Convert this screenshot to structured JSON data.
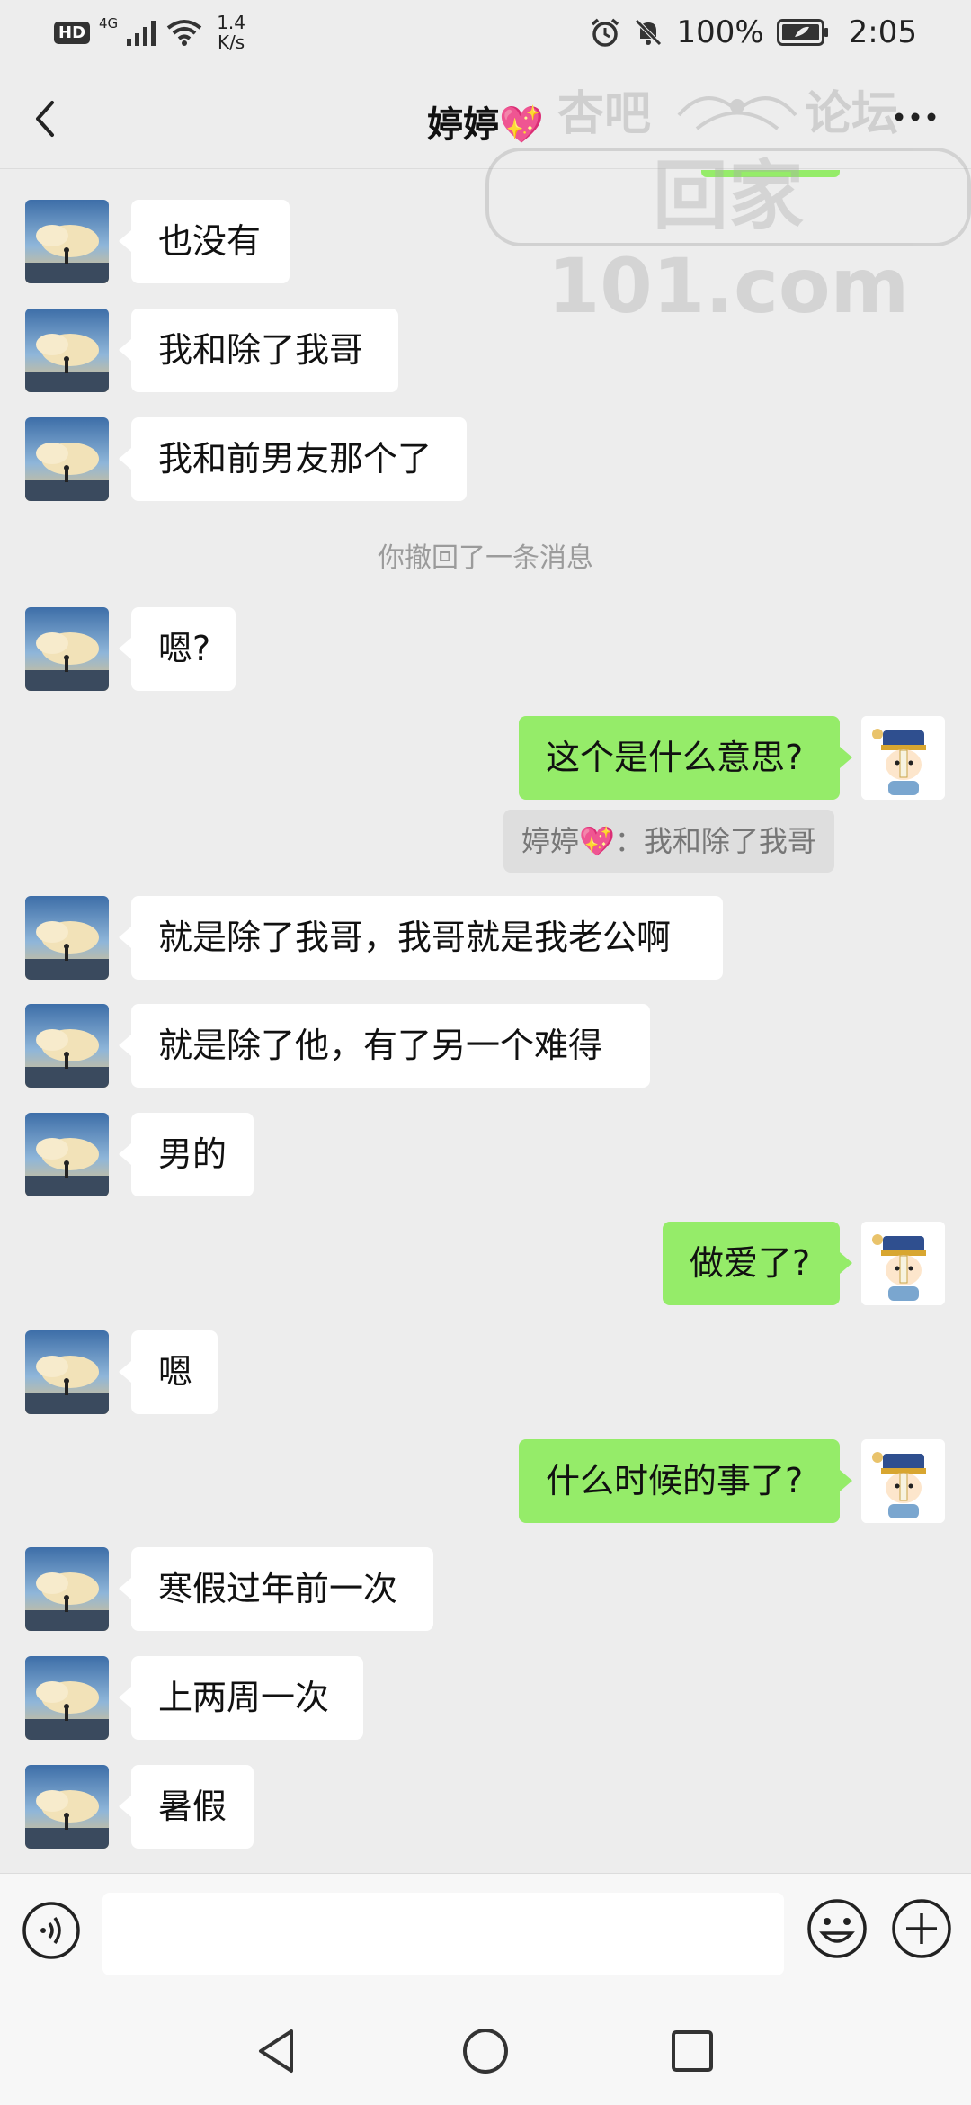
{
  "status_bar": {
    "hd": "HD",
    "network": "4G",
    "speed_value": "1.4",
    "speed_unit": "K/s",
    "battery": "100%",
    "time": "2:05"
  },
  "header": {
    "title": "婷婷💖"
  },
  "watermark": {
    "top_left": "杏吧",
    "top_right": "论坛",
    "main": "回家101.com"
  },
  "messages": [
    {
      "side": "left",
      "text": "也没有"
    },
    {
      "side": "left",
      "text": "我和除了我哥"
    },
    {
      "side": "left",
      "text": "我和前男友那个了"
    },
    {
      "side": "system",
      "text": "你撤回了一条消息"
    },
    {
      "side": "left",
      "text": "嗯?"
    },
    {
      "side": "right",
      "text": "这个是什么意思?"
    },
    {
      "side": "quote",
      "text": "婷婷💖：我和除了我哥"
    },
    {
      "side": "left",
      "text": "就是除了我哥，我哥就是我老公啊"
    },
    {
      "side": "left",
      "text": "就是除了他，有了另一个难得"
    },
    {
      "side": "left",
      "text": "男的"
    },
    {
      "side": "right",
      "text": "做爱了?"
    },
    {
      "side": "left",
      "text": "嗯"
    },
    {
      "side": "right",
      "text": "什么时候的事了?"
    },
    {
      "side": "left",
      "text": "寒假过年前一次"
    },
    {
      "side": "left",
      "text": "上两周一次"
    },
    {
      "side": "left",
      "text": "暑假"
    }
  ],
  "input": {
    "value": "",
    "placeholder": ""
  },
  "colors": {
    "background": "#ededed",
    "bubble_self": "#95ec69",
    "bubble_other": "#ffffff"
  },
  "icons": {
    "back": "chevron-left-icon",
    "more": "more-dots-icon",
    "voice": "voice-icon",
    "emoji": "emoji-icon",
    "plus": "plus-icon"
  }
}
